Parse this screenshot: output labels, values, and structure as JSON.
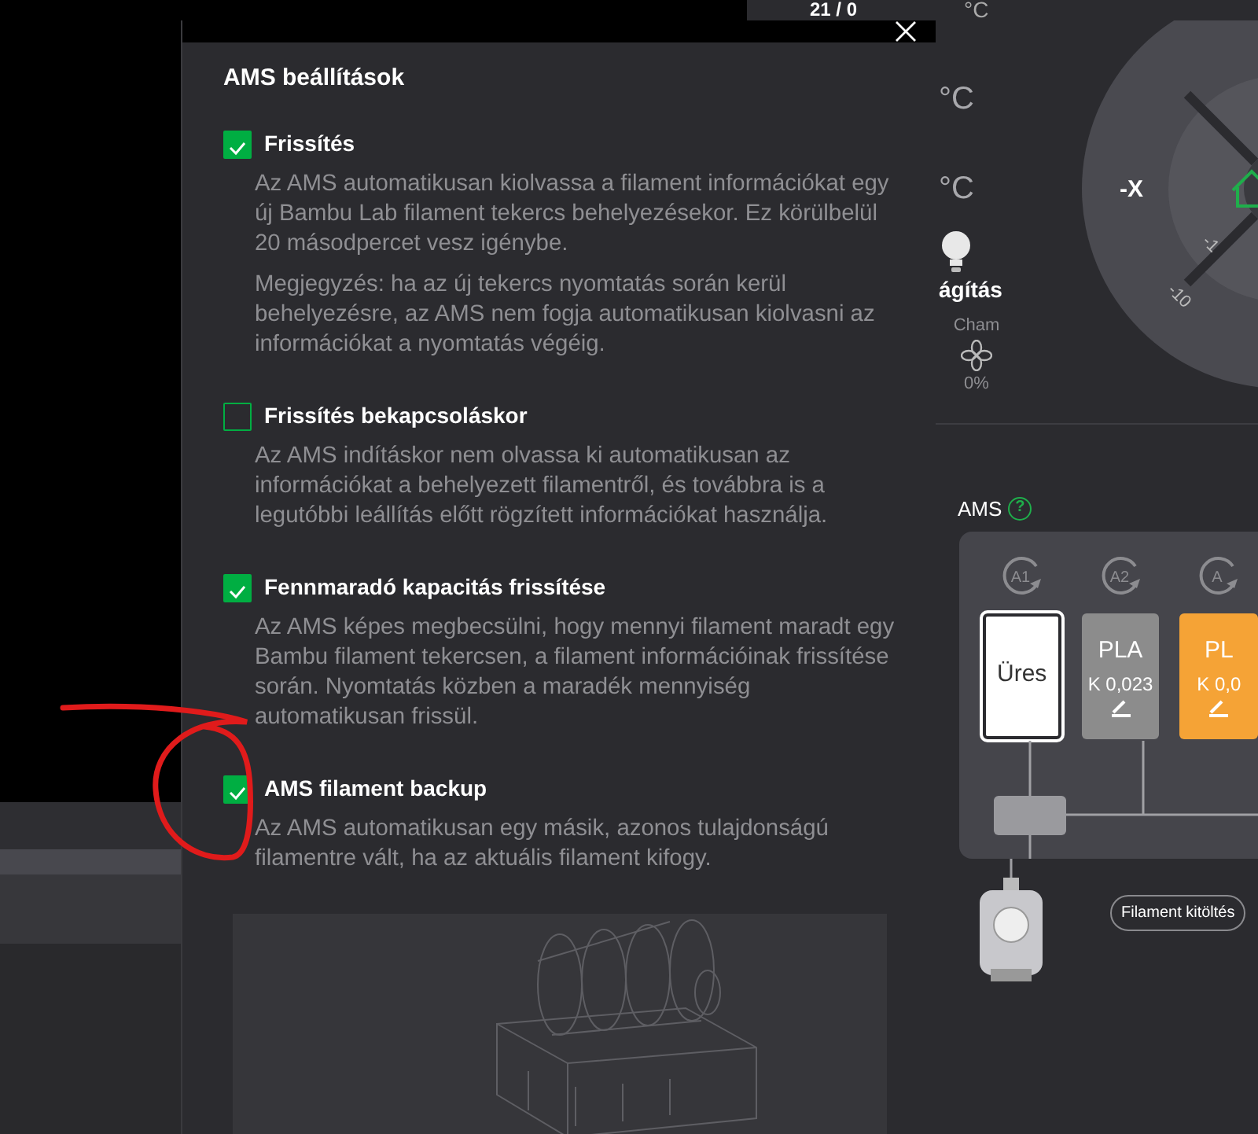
{
  "background": {
    "temperature_rows": [
      {
        "reading": "21 / 0",
        "unit": "°C"
      },
      {
        "unit": "°C"
      },
      {
        "unit": "°C"
      }
    ],
    "lighting_label": "ágítás",
    "chamber_fan": {
      "label": "Cham",
      "reading": "0%"
    },
    "jog": {
      "axis_label": "-X",
      "steps": [
        "-1",
        "-10"
      ]
    },
    "ams": {
      "title": "AMS",
      "help": "?",
      "slots": [
        {
          "id": "A1",
          "kind": "empty",
          "label": "Üres",
          "selected": true
        },
        {
          "id": "A2",
          "kind": "filament",
          "label": "PLA",
          "k": "K 0,023",
          "color": "#8c8c8c",
          "selected": false
        },
        {
          "id": "A",
          "kind": "filament",
          "label": "PL",
          "k": "K 0,0",
          "color": "#f5a336",
          "selected": false
        }
      ]
    },
    "fill_button": "Filament kitöltés"
  },
  "dialog": {
    "title": "AMS beállítások",
    "options": [
      {
        "label": "Frissítés",
        "checked": true,
        "paragraphs": [
          "Az AMS automatikusan kiolvassa a filament információkat egy új Bambu Lab filament tekercs behelyezésekor. Ez körülbelül 20 másodpercet vesz igénybe.",
          "Megjegyzés: ha az új tekercs nyomtatás során kerül behelyezésre, az AMS nem fogja automatikusan kiolvasni az információkat a nyomtatás végéig."
        ]
      },
      {
        "label": "Frissítés bekapcsoláskor",
        "checked": false,
        "paragraphs": [
          "Az AMS indításkor nem olvassa ki automatikusan az információkat a behelyezett filamentről, és továbbra is a legutóbbi leállítás előtt rögzített információkat használja."
        ]
      },
      {
        "label": "Fennmaradó kapacitás frissítése",
        "checked": true,
        "paragraphs": [
          "Az AMS képes megbecsülni, hogy mennyi filament maradt egy Bambu filament tekercsen, a filament információinak frissítése során. Nyomtatás közben a maradék mennyiség automatikusan frissül."
        ]
      },
      {
        "label": "AMS filament backup",
        "checked": true,
        "paragraphs": [
          "Az AMS automatikusan egy másik, azonos tulajdonságú filamentre vált, ha az aktuális filament kifogy."
        ]
      }
    ]
  }
}
